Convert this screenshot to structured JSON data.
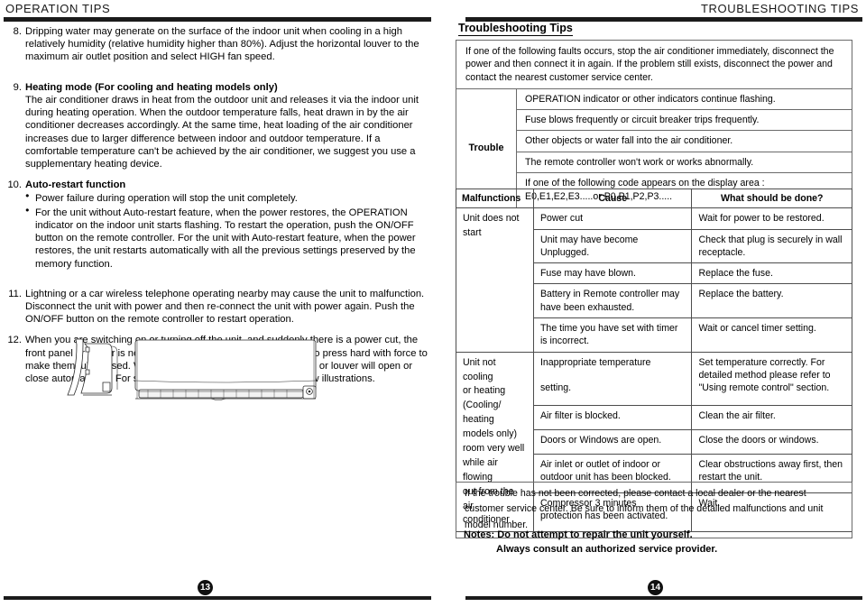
{
  "left": {
    "running_head": "OPERATION TIPS",
    "page_number": "13",
    "items": [
      {
        "num": "8.",
        "title": "",
        "text": "Dripping water may generate on the surface of the indoor unit when cooling in a high relatively humidity (relative humidity higher than 80%). Adjust the horizontal louver to the maximum air outlet position and select HIGH fan speed."
      },
      {
        "num": "9.",
        "title": "Heating mode (For cooling and heating models only)",
        "text": "The air conditioner draws in heat from the outdoor unit and releases it via the indoor unit during heating operation. When the outdoor temperature falls, heat drawn in by the air conditioner decreases accordingly. At the same time, heat loading of the air conditioner increases due to larger difference between indoor and outdoor temperature. If a comfortable temperature can't be achieved by the air conditioner, we suggest you use a supplementary heating device."
      },
      {
        "num": "10.",
        "title": "Auto-restart function",
        "bullets": [
          "Power failure during operation will stop the unit completely.",
          "For the unit without Auto-restart feature, when the power restores, the OPERATION indicator on the indoor unit starts flashing. To restart the operation, push the ON/OFF button on the remote controller. For the unit with Auto-restart feature, when the power restores, the unit restarts automatically with all the previous settings preserved by the memory function."
        ]
      },
      {
        "num": "11.",
        "title": "",
        "text": "Lightning or a car wireless telephone operating nearby may cause the unit to malfunction. Disconnect the unit with power and then re-connect the unit with power again. Push the ON/OFF button on the remote controller to restart operation."
      },
      {
        "num": "12.",
        "title": "",
        "text": "When you are switching on or  turning off the unit, and suddenly there is a power cut, the front panel or louver is not yet opened or closed, do not attempt to press hard with force to make them fully closed. When the power restores, the front panel or louver will open or close automatically. For specific occassions, please refer to below illustrations."
      }
    ],
    "illustration_caption": "indoor-unit-side-and-front-view"
  },
  "right": {
    "running_head": "TROUBLESHOOTING TIPS",
    "page_number": "14",
    "section_title": "Troubleshooting Tips",
    "intro": "If one of the following faults occurs, stop the air conditioner immediately, disconnect the power and then connect it in again. If the problem still exists, disconnect the power and contact the nearest customer service center.",
    "trouble_label": "Trouble",
    "trouble_rows": [
      "OPERATION indicator or other indicators continue flashing.",
      "Fuse blows frequently or circuit breaker trips frequently.",
      "Other objects or water fall into the air conditioner.",
      "The remote controller won't work or works abnormally.",
      "If one of the following code appears on the display area :\nE0,E1,E2,E3.....or P0,P1,P2,P3....."
    ],
    "table": {
      "headers": [
        "Malfunctions",
        "Cause",
        "What should be done?"
      ],
      "groups": [
        {
          "malfunction": "Unit does not\nstart",
          "rows": [
            {
              "cause": "Power cut",
              "action": "Wait for power to be restored."
            },
            {
              "cause": "Unit may have become Unplugged.",
              "action": "Check that plug is securely in wall\n  receptacle."
            },
            {
              "cause": "Fuse may have blown.",
              "action": "Replace the fuse."
            },
            {
              "cause": "Battery in Remote controller may\nhave been exhausted.",
              "action": "Replace the battery."
            },
            {
              "cause": "The time you have set with timer\nis incorrect.",
              "action": "Wait or cancel timer setting."
            }
          ]
        },
        {
          "malfunction": "Unit not cooling\nor heating\n(Cooling/ heating\n models only)\nroom very well\nwhile air flowing\nout from the air\nconditioner",
          "rows": [
            {
              "cause": "Inappropriate temperature\n\nsetting.",
              "action": "Set temperature correctly. For\ndetailed method please refer to\n\"Using remote control\" section."
            },
            {
              "cause": "Air filter is blocked.",
              "action": "Clean the air filter."
            },
            {
              "cause": "Doors or Windows are open.",
              "action": "Close the doors or windows."
            },
            {
              "cause": "Air inlet or outlet of indoor or\noutdoor unit has been blocked.",
              "action": "Clear obstructions away first, then\n restart the unit."
            },
            {
              "cause": "Compressor 3 minutes\nprotection has been activated.",
              "action": " Wait."
            }
          ]
        }
      ]
    },
    "footer_note": "If the trouble has not been corrected, please contact a local dealer or the nearest customer service center. Be sure to inform them of the detailed malfunctions and unit model number.",
    "notes_line1": "Notes: Do not attempt to repair the unit yourself.",
    "notes_line2": "Always consult an authorized service provider."
  }
}
